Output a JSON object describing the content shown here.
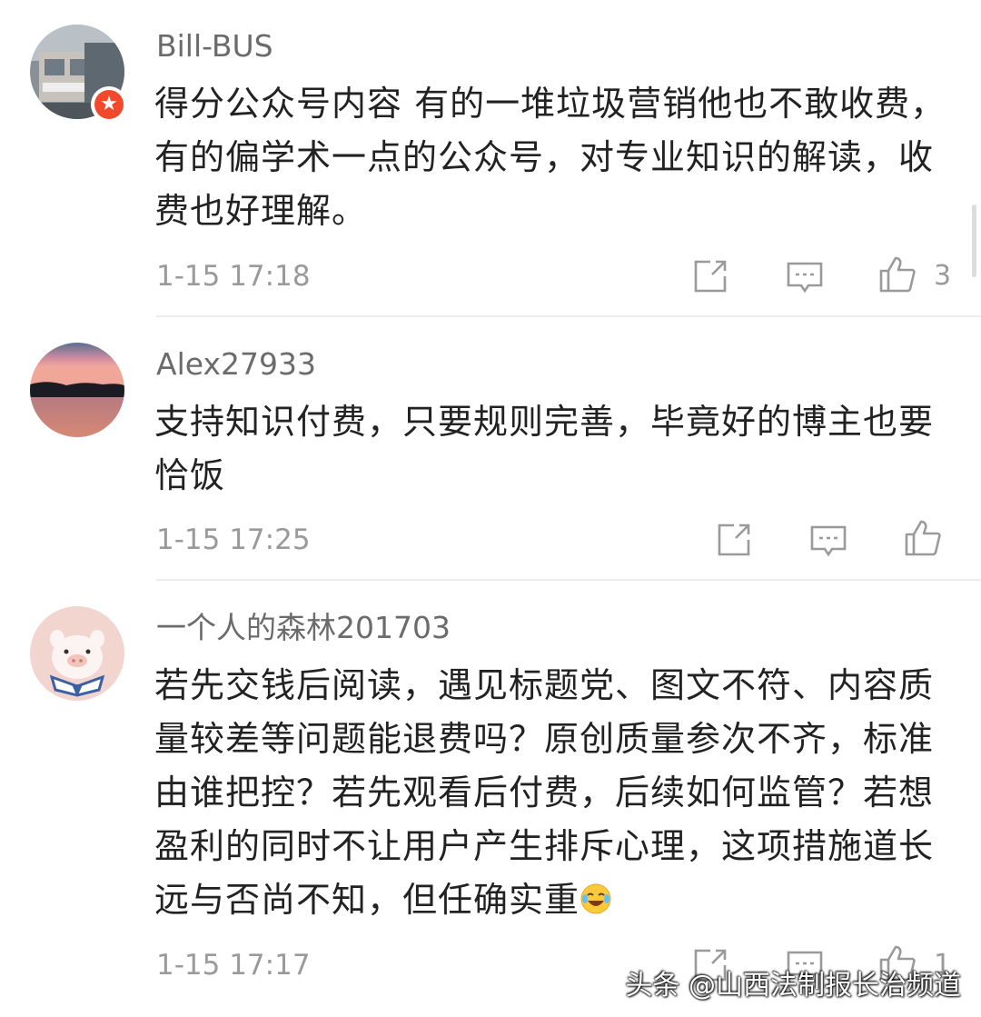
{
  "comments": [
    {
      "username": "Bill-BUS",
      "text": "得分公众号内容 有的一堆垃圾营销他也不敢收费，有的偏学术一点的公众号，对专业知识的解读，收费也好理解。",
      "time": "1-15 17:18",
      "likes": "3",
      "avatar_icon": "bus-photo-avatar",
      "badge_icon": "star-badge-icon"
    },
    {
      "username": "Alex27933",
      "text": "支持知识付费，只要规则完善，毕竟好的博主也要恰饭",
      "time": "1-15 17:25",
      "likes": "",
      "avatar_icon": "sunset-lake-avatar"
    },
    {
      "username": "一个人的森林201703",
      "text": "若先交钱后阅读，遇见标题党、图文不符、内容质量较差等问题能退费吗？原创质量参次不齐，标准由谁把控？若先观看后付费，后续如何监管？若想盈利的同时不让用户产生排斥心理，这项措施道长远与否尚不知，但任确实重",
      "emoji": "laughing-tears-emoji",
      "time": "1-15 17:17",
      "likes": "1",
      "avatar_icon": "piglet-avatar"
    }
  ],
  "icons": {
    "share": "share-icon",
    "reply": "comment-icon",
    "like": "thumbs-up-icon"
  },
  "watermark": "头条 @山西法制报长治频道",
  "colors": {
    "username": "#6b6b6b",
    "text": "#222222",
    "meta": "#9a9a9a",
    "badge": "#f2492c",
    "divider": "#ededed"
  }
}
